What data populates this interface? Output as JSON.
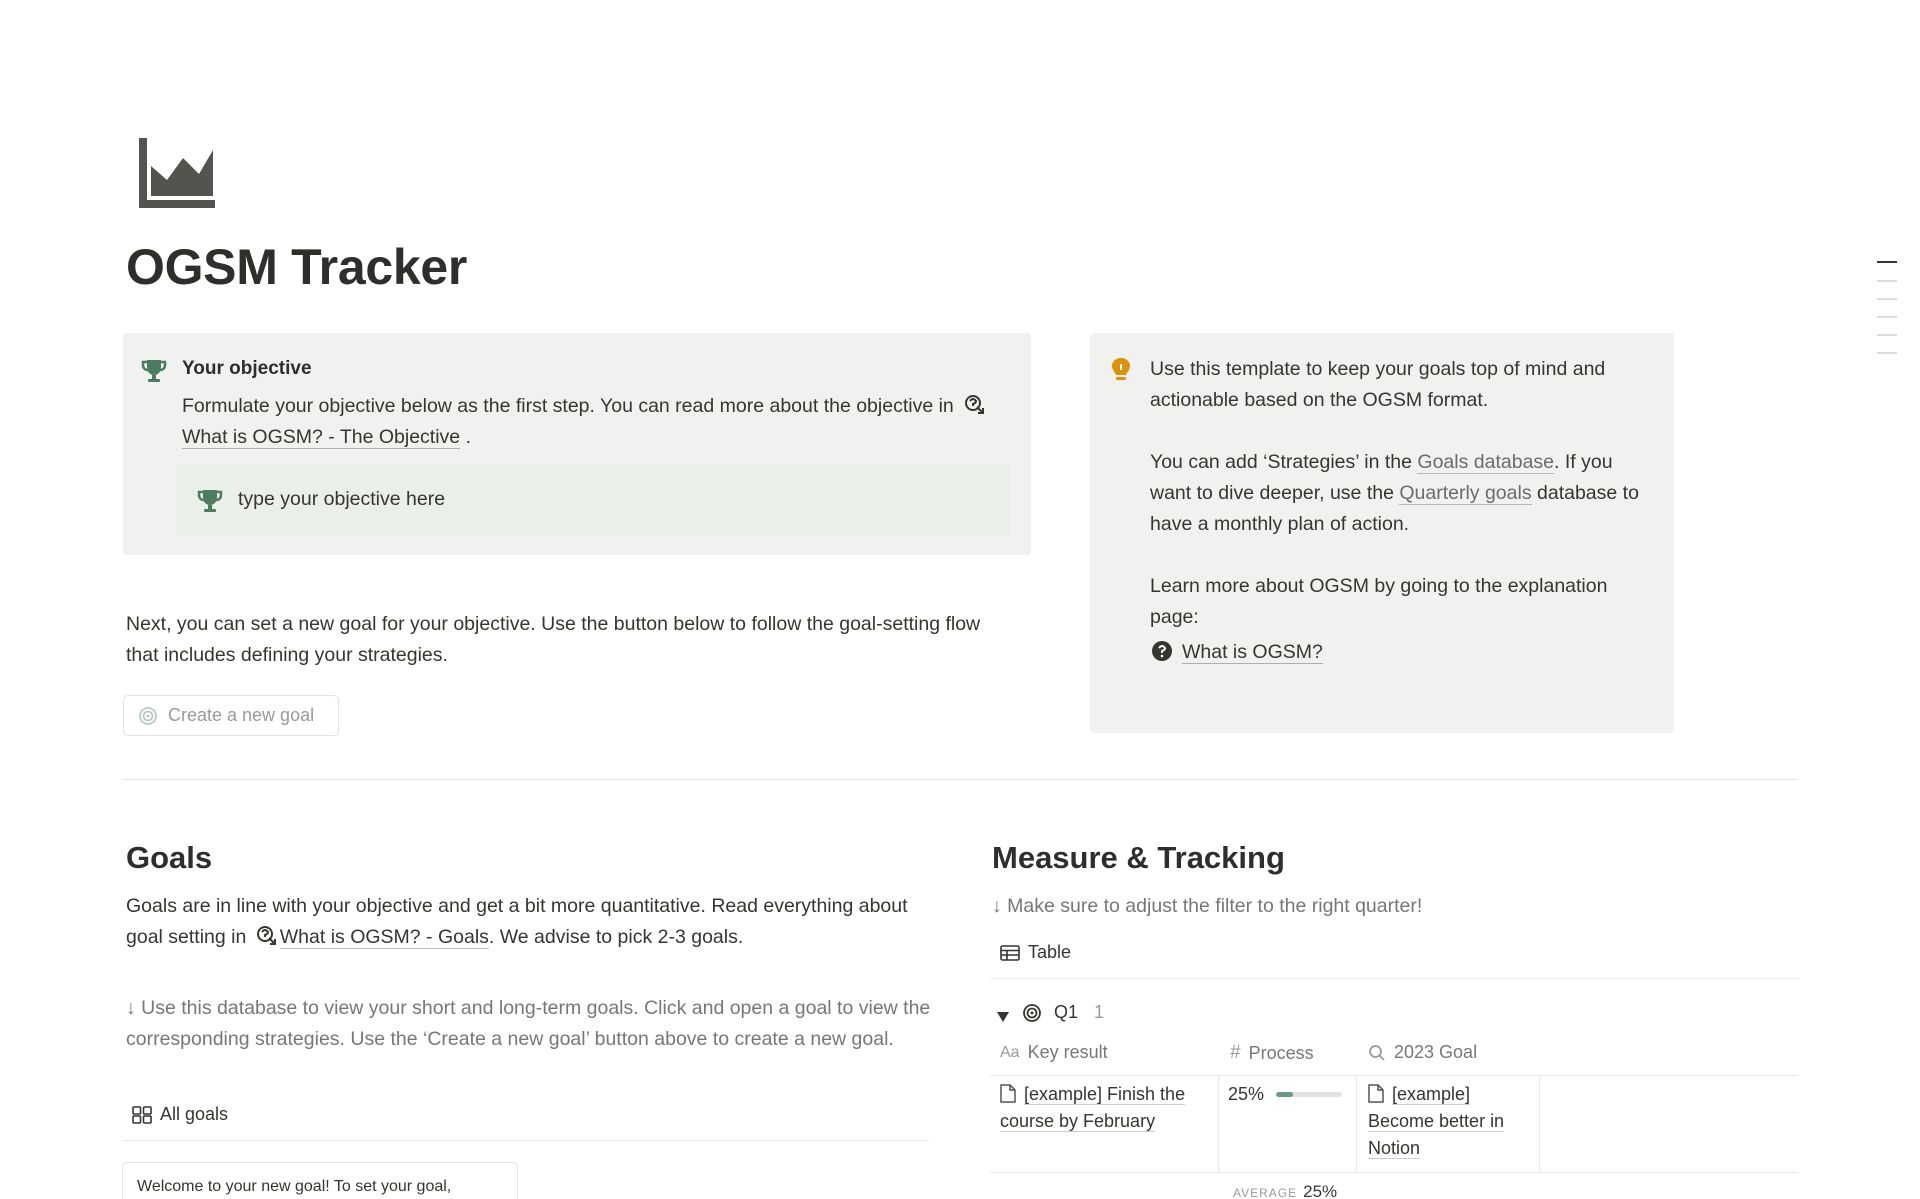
{
  "page": {
    "icon": "area-chart-icon",
    "title": "OGSM Tracker"
  },
  "objective_callout": {
    "icon": "trophy-icon",
    "title": "Your objective",
    "text_before": "Formulate your objective below as the first step. You can read more about the objective in",
    "link_icon": "ogsm-page-icon",
    "link_text": "What is OGSM? - The Objective",
    "text_after": ".",
    "inner_icon": "trophy-icon",
    "inner_text": "type your objective here"
  },
  "info_callout": {
    "icon": "lightbulb-icon",
    "p1": "Use this template to keep your goals top of mind and actionable based on the OGSM format.",
    "p2_before": "You can add ‘Strategies’ in the",
    "p2_link1": "Goals database",
    "p2_mid": ". If you want to dive deeper, use the",
    "p2_link2": "Quarterly goals",
    "p2_after": "database to have a monthly plan of action.",
    "p3": "Learn more about OGSM by going to the explanation page:",
    "link_icon": "question-page-icon",
    "link_text": "What is OGSM?"
  },
  "next_text": "Next, you can set a new goal for your objective. Use the button below to follow the goal-setting flow that includes defining your strategies.",
  "create_button": {
    "icon": "target-icon",
    "label": "Create a new goal"
  },
  "goals": {
    "heading": "Goals",
    "text_before": "Goals are in line with your objective and get a bit more quantitative. Read everything about goal setting in",
    "link_text": "What is OGSM? - Goals",
    "text_after": ". We advise to pick 2-3 goals.",
    "hint": "↓ Use this database to view your short and long-term goals. Click and open a goal to view the corresponding strategies. Use the ‘Create a new goal’ button above to create a new goal.",
    "view_icon": "gallery-icon",
    "view_label": "All goals",
    "card_text": "Welcome to your new goal! To set your goal,"
  },
  "measure": {
    "heading": "Measure & Tracking",
    "hint": "↓ Make sure to adjust the filter to the right quarter!",
    "view_icon": "table-icon",
    "view_label": "Table",
    "group": {
      "toggle_icon": "triangle-down-icon",
      "icon": "target-icon",
      "name": "Q1",
      "count": "1"
    },
    "columns": [
      {
        "icon": "Aa",
        "label": "Key result"
      },
      {
        "icon": "#",
        "label": "Process"
      },
      {
        "icon": "search-icon",
        "label": "2023 Goal"
      }
    ],
    "rows": [
      {
        "key_result": "[example] Finish the course by February",
        "process_label": "25%",
        "process_value": 0.25,
        "goal": "[example] Become better in Notion"
      }
    ],
    "footer": {
      "calc_label": "AVERAGE",
      "calc_value": "25%"
    }
  },
  "colors": {
    "callout_bg": "#f1f1ef",
    "inner_callout_bg": "#eaefe9",
    "trophy_green": "#4d7c61",
    "bulb_orange": "#d9930d",
    "progress_fill": "#6a9a80"
  }
}
